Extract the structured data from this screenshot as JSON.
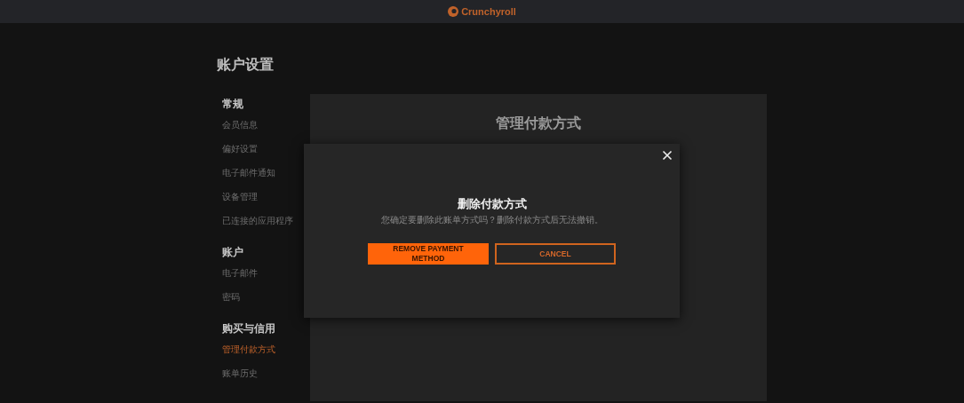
{
  "header": {
    "brand": "Crunchyroll"
  },
  "page_title": "账户设置",
  "sidebar": {
    "groups": [
      {
        "heading": "常规",
        "items": [
          {
            "label": "会员信息",
            "selected": false
          },
          {
            "label": "偏好设置",
            "selected": false
          },
          {
            "label": "电子邮件通知",
            "selected": false
          },
          {
            "label": "设备管理",
            "selected": false
          },
          {
            "label": "已连接的应用程序",
            "selected": false
          }
        ]
      },
      {
        "heading": "账户",
        "items": [
          {
            "label": "电子邮件",
            "selected": false
          },
          {
            "label": "密码",
            "selected": false
          }
        ]
      },
      {
        "heading": "购买与信用",
        "items": [
          {
            "label": "管理付款方式",
            "selected": true
          },
          {
            "label": "账单历史",
            "selected": false
          }
        ]
      }
    ]
  },
  "panel": {
    "title": "管理付款方式"
  },
  "dialog": {
    "title": "删除付款方式",
    "message": "您确定要删除此账单方式吗？删除付款方式后无法撤销。",
    "buttons": [
      {
        "label": "REMOVE PAYMENT METHOD",
        "kind": "primary"
      },
      {
        "label": "CANCEL",
        "kind": "secondary"
      }
    ]
  }
}
